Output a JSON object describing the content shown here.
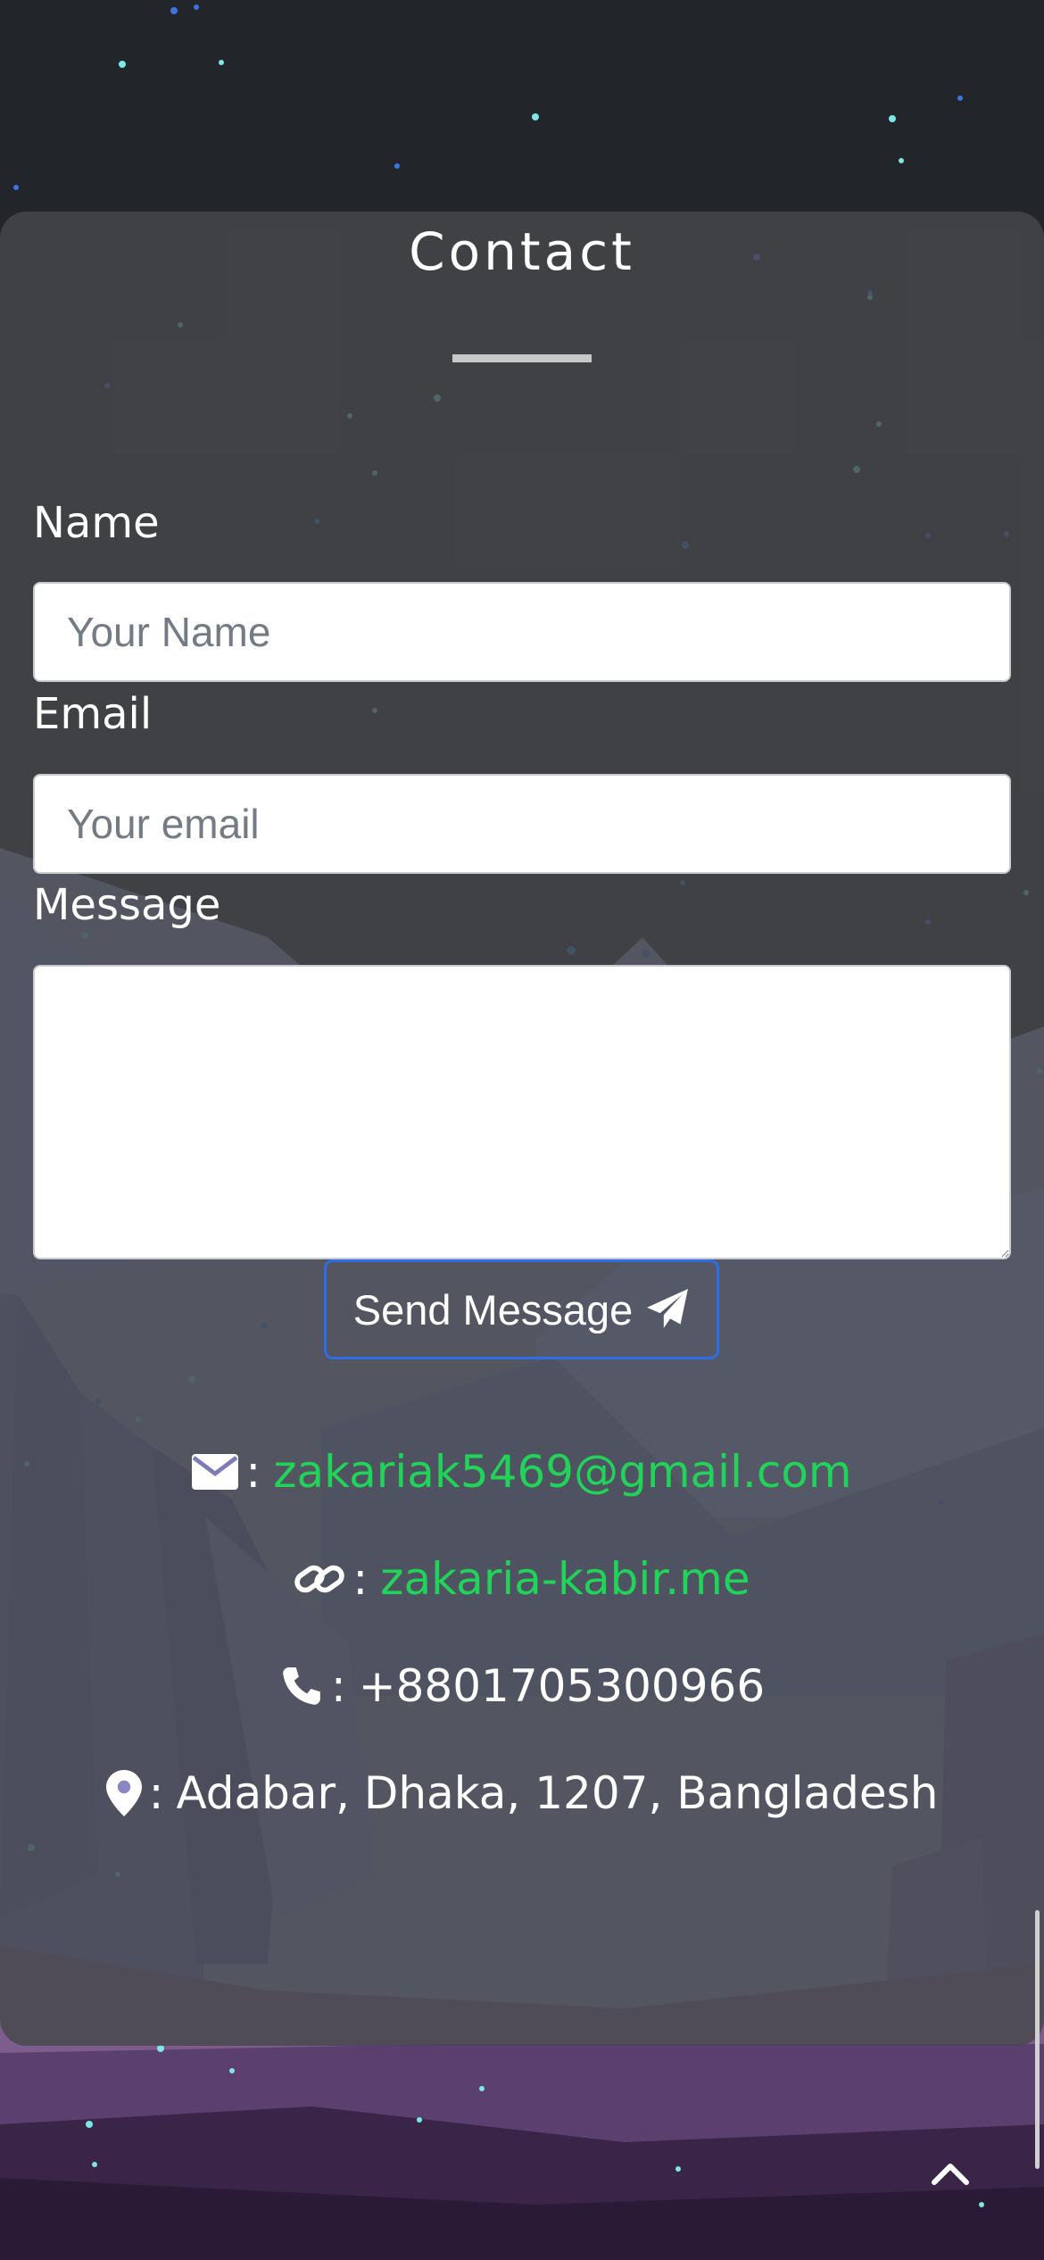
{
  "contact": {
    "title": "Contact",
    "name_label": "Name",
    "name_placeholder": "Your Name",
    "name_value": "",
    "email_label": "Email",
    "email_placeholder": "Your email",
    "email_value": "",
    "message_label": "Message",
    "message_value": "",
    "send_button_label": "Send Message"
  },
  "info": {
    "separator": ":",
    "email": "zakariak5469@gmail.com",
    "website": "zakaria-kabir.me",
    "phone": "+8801705300966",
    "address": "Adabar, Dhaka, 1207, Bangladesh"
  },
  "icons": {
    "email": "envelope-icon",
    "website": "link-icon",
    "phone": "phone-icon",
    "address": "map-marker-icon",
    "send": "paper-plane-icon",
    "scroll_top": "chevron-up-icon"
  },
  "colors": {
    "link": "#22d35a",
    "button_border": "#2f6de6",
    "card": "#46484c",
    "night_sky": "#22252a"
  }
}
